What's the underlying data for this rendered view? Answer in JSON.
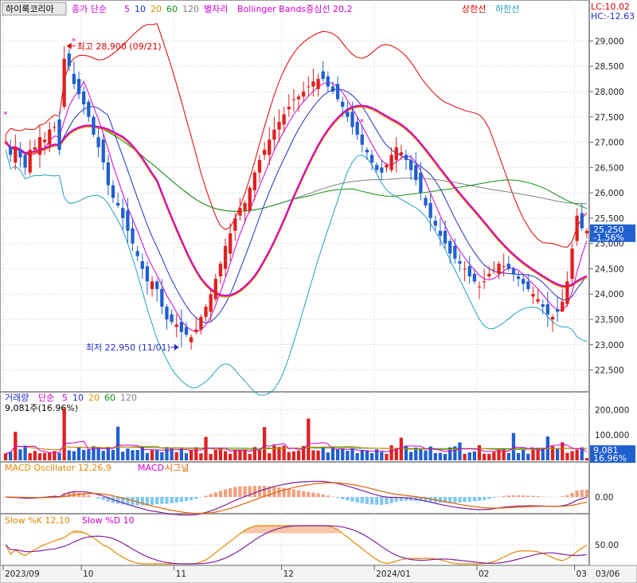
{
  "header": {
    "title": "하이록코리아",
    "items": [
      {
        "text": "종가 단순",
        "color": "#d000d0"
      },
      {
        "text": "5",
        "color": "#d000d0"
      },
      {
        "text": "10",
        "color": "#2030c0"
      },
      {
        "text": "20",
        "color": "#e08a00"
      },
      {
        "text": "60",
        "color": "#109010"
      },
      {
        "text": "120",
        "color": "#808080"
      },
      {
        "text": "별자리",
        "color": "#d000d0"
      },
      {
        "text": "Bollinger Bands중심선 20,2",
        "color": "#d000d0"
      },
      {
        "text": "상한선",
        "color": "#e00000"
      },
      {
        "text": "하한선",
        "color": "#20a0c0"
      }
    ],
    "lc": "LC:10.02",
    "hc": "HC:-12.63"
  },
  "annotations": {
    "high": "최고 28,900 (09/21)",
    "low": "최저 22,950 (11/01)"
  },
  "price_panel": {
    "ticks": [
      "29,000",
      "28,500",
      "28,000",
      "27,500",
      "27,000",
      "26,500",
      "26,000",
      "25,500",
      "25,000",
      "24,500",
      "24,000",
      "23,500",
      "23,000",
      "22,500"
    ],
    "current_price": "25,250",
    "current_change": "-1.56%"
  },
  "volume_panel": {
    "legend": [
      {
        "text": "거래량",
        "color": "#2030c0"
      },
      {
        "text": "단순",
        "color": "#d000d0"
      },
      {
        "text": "5",
        "color": "#d000d0"
      },
      {
        "text": "10",
        "color": "#2030c0"
      },
      {
        "text": "20",
        "color": "#e08a00"
      },
      {
        "text": "60",
        "color": "#109010"
      },
      {
        "text": "120",
        "color": "#808080"
      }
    ],
    "info": "9,081주(16.96%)",
    "ticks": [
      "200,000",
      "100,000"
    ],
    "current_volume": "9,081",
    "current_pct": "16.96%"
  },
  "macd_panel": {
    "legend": [
      {
        "text": "MACD Oscillator 12,26,9",
        "color": "#e08a00"
      },
      {
        "text": "MACD",
        "color": "#d000d0"
      },
      {
        "text": "시그널",
        "color": "#e06000"
      }
    ],
    "ticks": [
      "0.00"
    ]
  },
  "stoch_panel": {
    "legend": [
      {
        "text": "Slow %K 12,10",
        "color": "#e08a00"
      },
      {
        "text": "Slow %D 10",
        "color": "#d000d0"
      }
    ],
    "ticks": [
      "50.00"
    ]
  },
  "x_axis": {
    "labels": [
      {
        "text": "2023/09",
        "idx": 0
      },
      {
        "text": "10",
        "idx": 16
      },
      {
        "text": "11",
        "idx": 35
      },
      {
        "text": "12",
        "idx": 57
      },
      {
        "text": "2024/01",
        "idx": 76
      },
      {
        "text": "02",
        "idx": 97
      },
      {
        "text": "03",
        "idx": 117
      }
    ],
    "right_label": "03/06"
  },
  "colors": {
    "up": "#e02020",
    "down": "#2060d0",
    "grid": "#c8c8c8"
  },
  "chart_data": {
    "type": "candlestick",
    "title": "하이록코리아",
    "y_range": [
      22100,
      29400
    ],
    "high_label_value": 28900,
    "low_label_value": 22950,
    "closes": [
      27000,
      26750,
      26900,
      26700,
      26500,
      26850,
      26900,
      27100,
      27050,
      27250,
      27300,
      26850,
      28650,
      28500,
      28150,
      27950,
      27750,
      27500,
      27150,
      26900,
      26600,
      26150,
      25900,
      25750,
      25500,
      25250,
      25000,
      24750,
      24500,
      24250,
      24250,
      24100,
      23750,
      23500,
      23450,
      23400,
      23250,
      23200,
      23150,
      23300,
      23550,
      23750,
      24000,
      24300,
      24600,
      24950,
      25200,
      25500,
      25700,
      25800,
      26100,
      26400,
      26650,
      26850,
      27050,
      27250,
      27400,
      27550,
      27700,
      27850,
      27900,
      28000,
      28100,
      28200,
      28250,
      28250,
      28100,
      28000,
      27850,
      27700,
      27500,
      27300,
      27150,
      26950,
      26800,
      26600,
      26450,
      26400,
      26550,
      26750,
      26900,
      26800,
      26650,
      26450,
      26250,
      26000,
      25750,
      25500,
      25350,
      25150,
      25000,
      24800,
      24700,
      24600,
      24500,
      24350,
      24250,
      24150,
      24250,
      24400,
      24500,
      24600,
      24550,
      24500,
      24400,
      24300,
      24200,
      24100,
      24000,
      23900,
      23750,
      23600,
      23550,
      23650,
      23850,
      24250,
      24900,
      25550,
      25300,
      25250
    ]
  }
}
